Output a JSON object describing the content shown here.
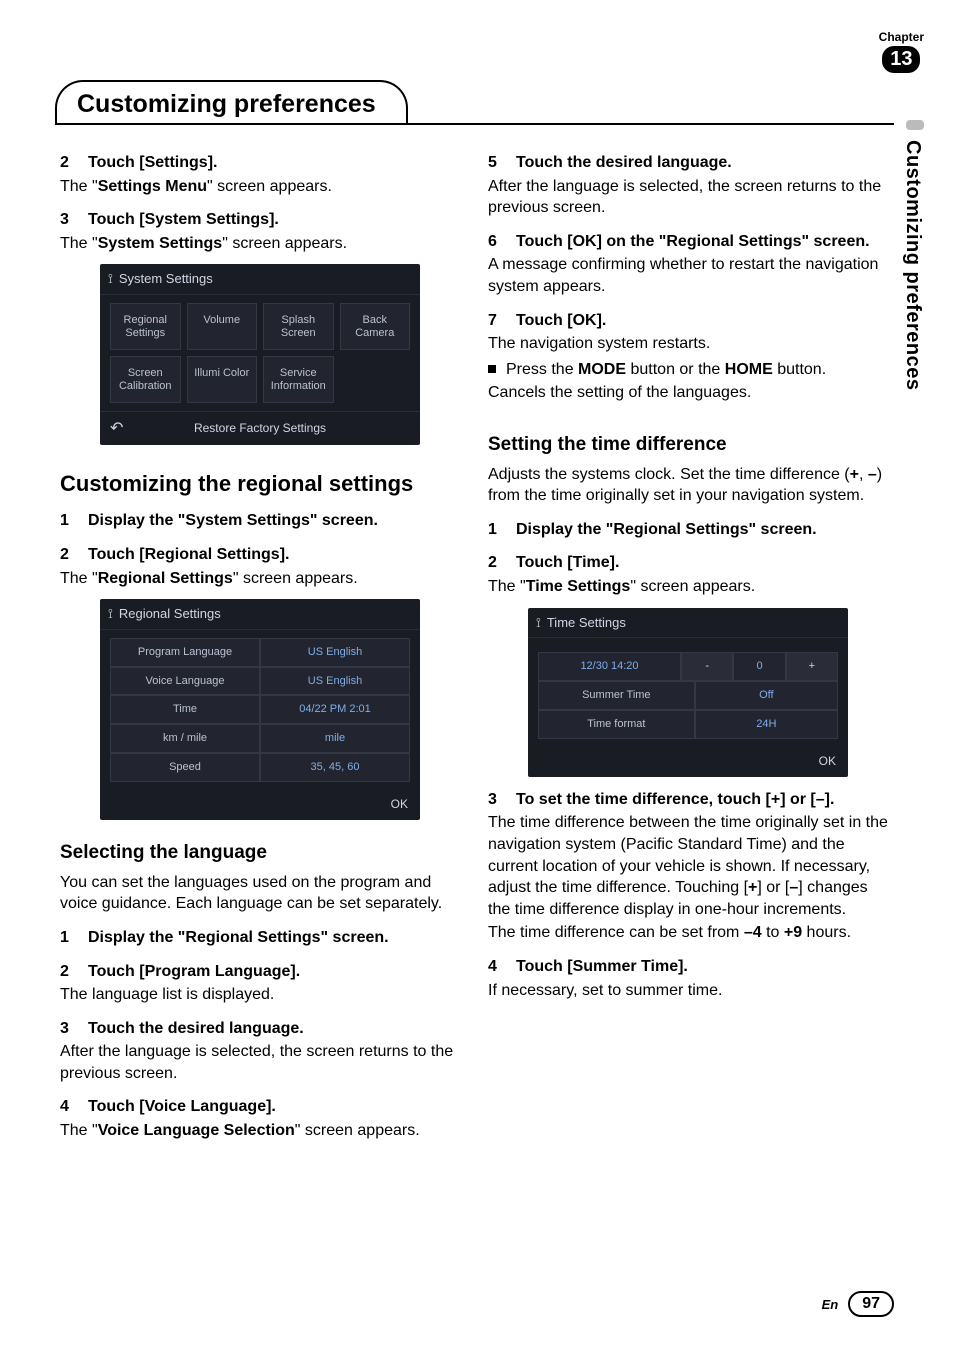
{
  "header": {
    "chapter_label": "Chapter",
    "chapter_number": "13",
    "title": "Customizing preferences",
    "side_tab": "Customizing preferences"
  },
  "left": {
    "s2": {
      "num": "2",
      "title": "Touch [Settings].",
      "desc_pre": "The \"",
      "desc_bold": "Settings Menu",
      "desc_post": "\" screen appears."
    },
    "s3": {
      "num": "3",
      "title": "Touch [System Settings].",
      "desc_pre": "The \"",
      "desc_bold": "System Settings",
      "desc_post": "\" screen appears."
    },
    "ss1": {
      "title": "System Settings",
      "tiles": [
        "Regional Settings",
        "Volume",
        "Splash Screen",
        "Back Camera",
        "Screen Calibration",
        "Illumi Color",
        "Service Information",
        ""
      ],
      "footer": "Restore Factory Settings"
    },
    "h2": "Customizing the regional settings",
    "rs1": {
      "num": "1",
      "title": "Display the \"System Settings\" screen."
    },
    "rs2": {
      "num": "2",
      "title": "Touch [Regional Settings].",
      "desc_pre": "The \"",
      "desc_bold": "Regional Settings",
      "desc_post": "\" screen appears."
    },
    "ss2": {
      "title": "Regional Settings",
      "rows": [
        {
          "label": "Program Language",
          "value": "US English"
        },
        {
          "label": "Voice Language",
          "value": "US English"
        },
        {
          "label": "Time",
          "value": "04/22 PM 2:01"
        },
        {
          "label": "km / mile",
          "value": "mile"
        },
        {
          "label": "Speed",
          "value": "35, 45, 60"
        }
      ],
      "ok": "OK"
    },
    "h3": "Selecting the language",
    "p1": "You can set the languages used on the program and voice guidance. Each language can be set separately.",
    "sl1": {
      "num": "1",
      "title": "Display the \"Regional Settings\" screen."
    },
    "sl2": {
      "num": "2",
      "title": "Touch [Program Language].",
      "desc": "The language list is displayed."
    },
    "sl3": {
      "num": "3",
      "title": "Touch the desired language.",
      "desc": "After the language is selected, the screen returns to the previous screen."
    },
    "sl4": {
      "num": "4",
      "title": "Touch [Voice Language].",
      "desc_pre": "The \"",
      "desc_bold": "Voice Language Selection",
      "desc_post": "\" screen appears."
    }
  },
  "right": {
    "s5": {
      "num": "5",
      "title": "Touch the desired language.",
      "desc": "After the language is selected, the screen returns to the previous screen."
    },
    "s6": {
      "num": "6",
      "title": "Touch [OK] on the \"Regional Settings\" screen.",
      "desc": "A message confirming whether to restart the navigation system appears."
    },
    "s7": {
      "num": "7",
      "title": "Touch [OK].",
      "desc": "The navigation system restarts.",
      "bullet_pre": "Press the ",
      "bullet_b1": "MODE",
      "bullet_mid": " button or the ",
      "bullet_b2": "HOME",
      "bullet_post": " button.",
      "desc2": "Cancels the setting of the languages."
    },
    "h3": "Setting the time difference",
    "p1_pre": "Adjusts the systems clock. Set the time difference (",
    "p1_b1": "+",
    "p1_mid": ", ",
    "p1_b2": "–",
    "p1_post": ") from the time originally set in your navigation system.",
    "td1": {
      "num": "1",
      "title": "Display the \"Regional Settings\" screen."
    },
    "td2": {
      "num": "2",
      "title": "Touch [Time].",
      "desc_pre": "The \"",
      "desc_bold": "Time Settings",
      "desc_post": "\" screen appears."
    },
    "ss3": {
      "title": "Time Settings",
      "row1": {
        "time": "12/30 14:20",
        "minus": "-",
        "zero": "0",
        "plus": "+"
      },
      "row2": {
        "label": "Summer Time",
        "value": "Off"
      },
      "row3": {
        "label": "Time format",
        "value": "24H"
      },
      "ok": "OK"
    },
    "td3": {
      "num": "3",
      "title": "To set the time difference, touch [+] or [–].",
      "desc_a": "The time difference between the time originally set in the navigation system (Pacific Standard Time) and the current location of your vehicle is shown. If necessary, adjust the time difference. Touching [",
      "desc_b1": "+",
      "desc_mid": "] or [",
      "desc_b2": "–",
      "desc_c": "] changes the time difference display in one-hour increments.",
      "desc_d_pre": "The time difference can be set from ",
      "desc_d_b1": "–4",
      "desc_d_mid": " to ",
      "desc_d_b2": "+9",
      "desc_d_post": " hours."
    },
    "td4": {
      "num": "4",
      "title": "Touch [Summer Time].",
      "desc": "If necessary, set to summer time."
    }
  },
  "footer": {
    "en": "En",
    "page": "97"
  }
}
